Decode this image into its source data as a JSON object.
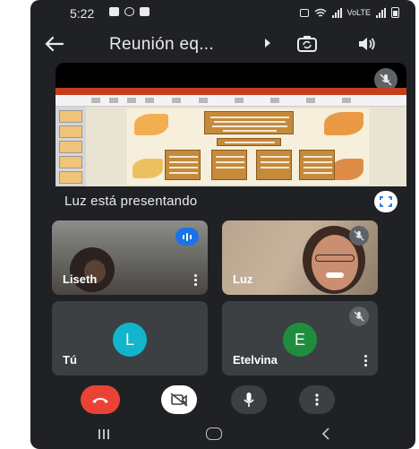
{
  "status_bar": {
    "time": "5:22",
    "network_label": "VoLTE"
  },
  "top_bar": {
    "title": "Reunión eq..."
  },
  "presentation": {
    "presenter_label": "Luz está presentando"
  },
  "participants": [
    {
      "name": "Liseth",
      "speaking": true
    },
    {
      "name": "Luz",
      "muted": true
    },
    {
      "name": "Tú",
      "avatar_letter": "L",
      "avatar_color": "#12b5cb"
    },
    {
      "name": "Etelvina",
      "avatar_letter": "E",
      "avatar_color": "#1e8e3e",
      "muted": true
    }
  ],
  "colors": {
    "background": "#202124",
    "tile": "#3c4043",
    "hangup": "#ea4335",
    "speaking_badge": "#1a73e8"
  },
  "icons": {
    "back": "arrow-left-icon",
    "camera_switch": "camera-switch-icon",
    "speaker": "speaker-icon",
    "fullscreen": "fullscreen-icon",
    "hangup": "phone-hangup-icon",
    "camera": "camera-off-icon",
    "mic": "mic-icon",
    "more": "more-vert-icon"
  }
}
